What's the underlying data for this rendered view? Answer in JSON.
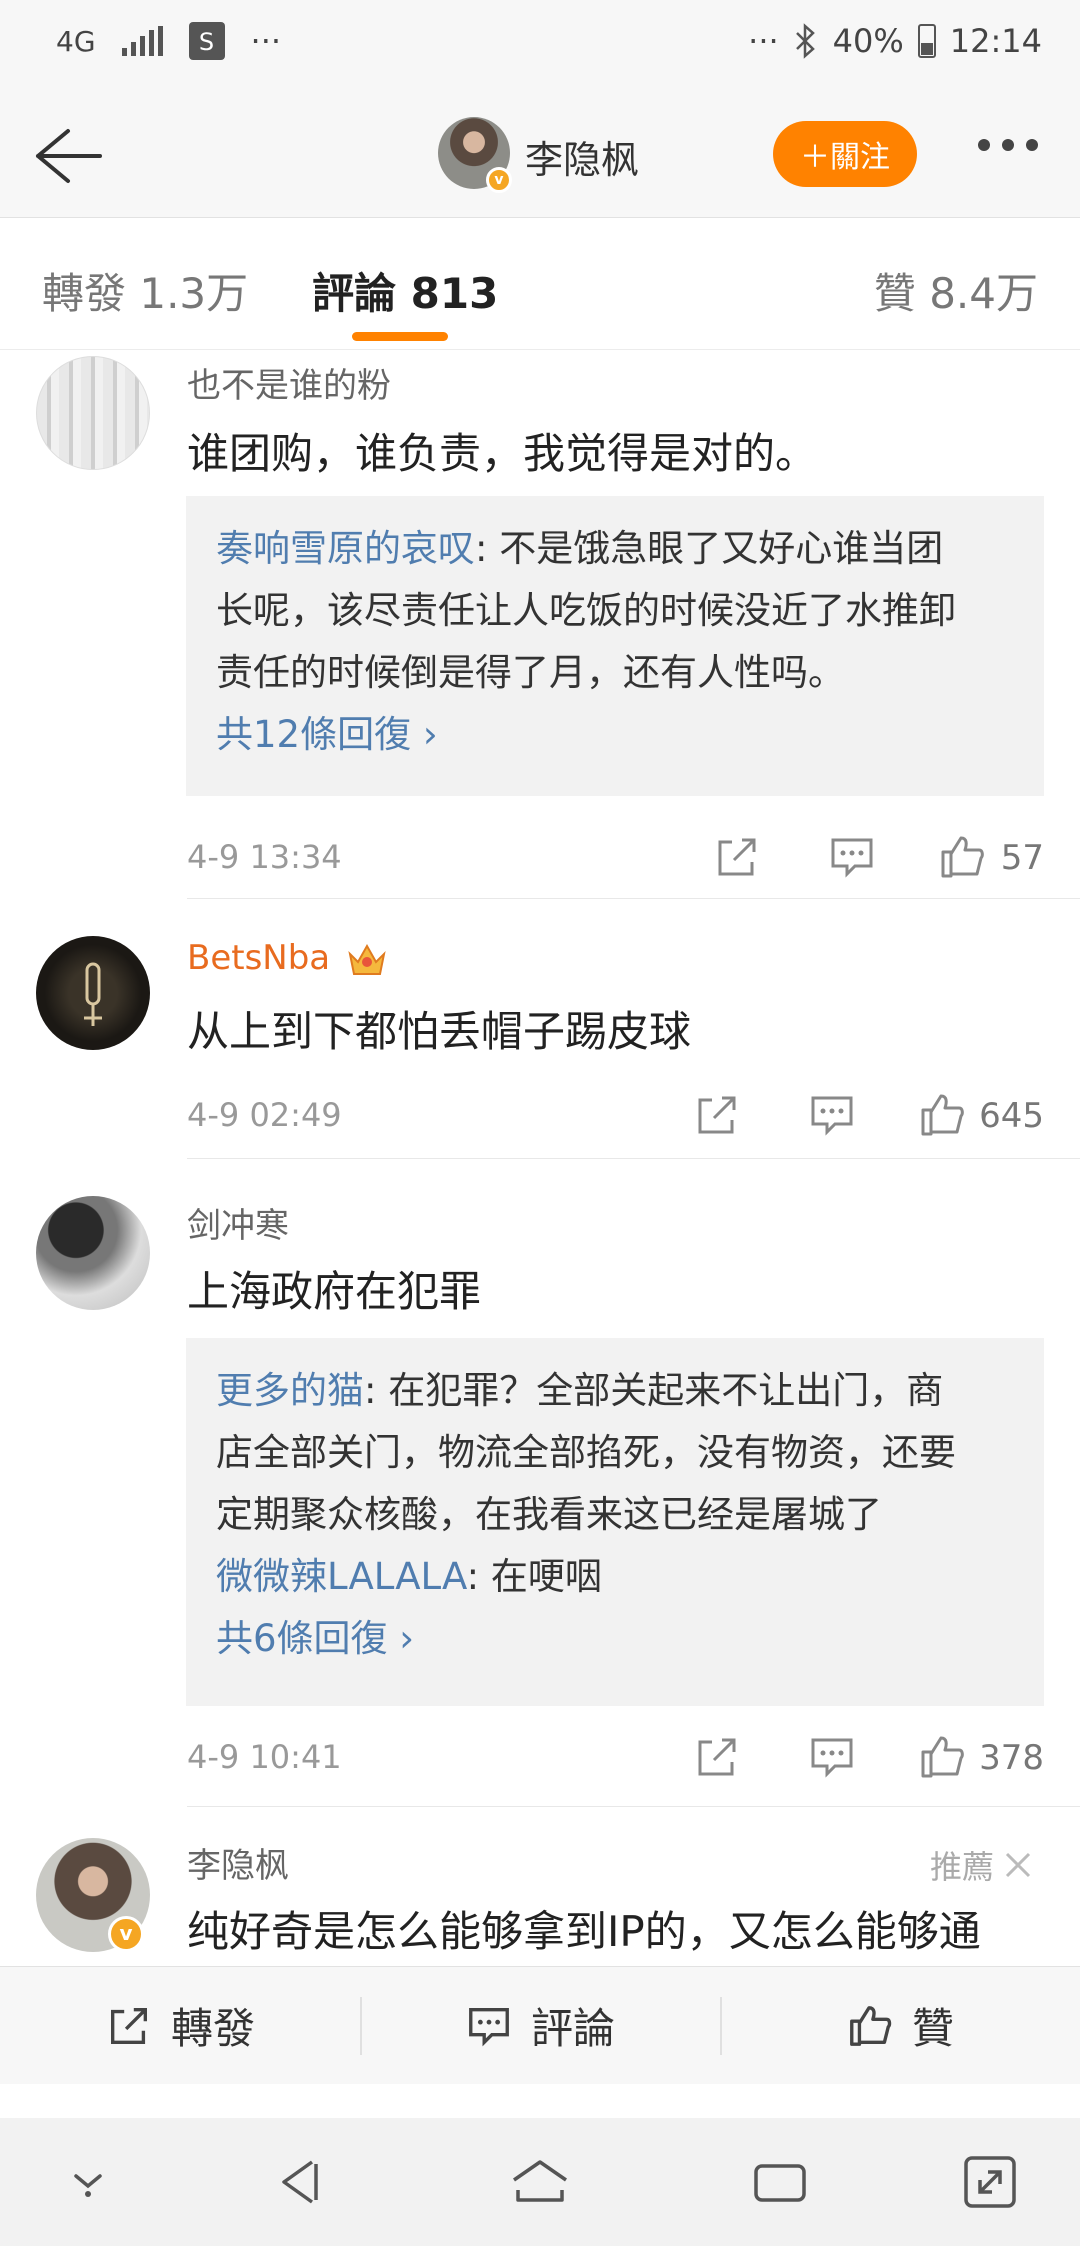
{
  "status_bar": {
    "network": "4G",
    "store_icon": "S",
    "overflow": "···",
    "right_overflow": "···",
    "battery": "40%",
    "time": "12:14",
    "icons": [
      "signal-icon",
      "store-bag-icon",
      "bluetooth-icon",
      "battery-icon"
    ]
  },
  "header": {
    "title": "李隐枫",
    "follow_label": "＋關注"
  },
  "tabs": [
    {
      "label": "轉發 1.3万",
      "active": false
    },
    {
      "label": "評論 813",
      "active": true
    },
    {
      "label": "贊 8.4万",
      "active": false
    }
  ],
  "comments": [
    {
      "user": "也不是谁的粉",
      "text": "谁团购，谁负责，我觉得是对的。",
      "replies": [
        {
          "user": "奏响雪原的哀叹",
          "text": ": 不是饿急眼了又好心谁当团",
          "cont1": "长呢，该尽责任让人吃饭的时候没近了水推卸",
          "cont2": "责任的时候倒是得了月，还有人性吗。"
        }
      ],
      "reply_count": "共12條回復 ›",
      "time": "4-9 13:34",
      "likes": "57"
    },
    {
      "user": "BetsNba",
      "text": "从上到下都怕丢帽子踢皮球",
      "time": "4-9 02:49",
      "likes": "645"
    },
    {
      "user": "剑冲寒",
      "text": "上海政府在犯罪",
      "replies": [
        {
          "user": "更多的猫",
          "text": ": 在犯罪？全部关起来不让出门，商",
          "cont1": "店全部关门，物流全部掐死，没有物资，还要",
          "cont2": "定期聚众核酸，在我看来这已经是屠城了"
        },
        {
          "user": "微微辣LALALA",
          "text": ": 在哽咽"
        }
      ],
      "reply_count": "共6條回復 ›",
      "time": "4-9 10:41",
      "likes": "378"
    },
    {
      "user": "李隐枫",
      "text": "纯好奇是怎么能够拿到IP的，又怎么能够通",
      "recommend": "推薦"
    }
  ],
  "action_bar": {
    "repost": "轉發",
    "comment": "評論",
    "like": "贊"
  },
  "colors": {
    "accent": "#ff8200",
    "link": "#507daf",
    "vip_name": "#e86b1f"
  }
}
